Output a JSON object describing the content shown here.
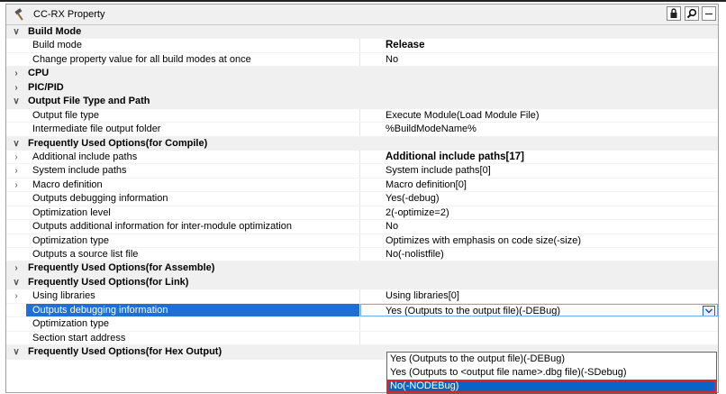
{
  "window": {
    "title": "CC-RX Property"
  },
  "toolbar": {
    "icons": [
      "lock-icon",
      "search-icon",
      "minimize-icon"
    ]
  },
  "rows": [
    {
      "type": "cat",
      "expander": "expanded",
      "name": "Build Mode"
    },
    {
      "type": "prop",
      "name": "Build mode",
      "value": "Release",
      "strong": true
    },
    {
      "type": "prop",
      "name": "Change property value for all build modes at once",
      "value": "No"
    },
    {
      "type": "cat",
      "expander": "collapsed",
      "name": "CPU"
    },
    {
      "type": "cat",
      "expander": "collapsed",
      "name": "PIC/PID"
    },
    {
      "type": "cat",
      "expander": "expanded",
      "name": "Output File Type and Path"
    },
    {
      "type": "prop",
      "name": "Output file type",
      "value": "Execute Module(Load Module File)"
    },
    {
      "type": "prop",
      "name": "Intermediate file output folder",
      "value": "%BuildModeName%"
    },
    {
      "type": "cat",
      "expander": "expanded",
      "name": "Frequently Used Options(for Compile)"
    },
    {
      "type": "prop",
      "expander": "collapsed",
      "name": "Additional include paths",
      "value": "Additional include paths[17]",
      "strong": true
    },
    {
      "type": "prop",
      "expander": "collapsed",
      "name": "System include paths",
      "value": "System include paths[0]"
    },
    {
      "type": "prop",
      "expander": "collapsed",
      "name": "Macro definition",
      "value": "Macro definition[0]"
    },
    {
      "type": "prop",
      "name": "Outputs debugging information",
      "value": "Yes(-debug)"
    },
    {
      "type": "prop",
      "name": "Optimization level",
      "value": "2(-optimize=2)"
    },
    {
      "type": "prop",
      "name": "Outputs additional information for inter-module optimization",
      "value": "No"
    },
    {
      "type": "prop",
      "name": "Optimization type",
      "value": "Optimizes with emphasis on code size(-size)"
    },
    {
      "type": "prop",
      "name": "Outputs a source list file",
      "value": "No(-nolistfile)"
    },
    {
      "type": "cat",
      "expander": "collapsed",
      "name": "Frequently Used Options(for Assemble)"
    },
    {
      "type": "cat",
      "expander": "expanded",
      "name": "Frequently Used Options(for Link)"
    },
    {
      "type": "prop",
      "expander": "collapsed",
      "name": "Using libraries",
      "value": "Using libraries[0]"
    },
    {
      "type": "prop",
      "name": "Outputs debugging information",
      "value": "Yes (Outputs to the output file)(-DEBug)",
      "selected": true
    },
    {
      "type": "prop",
      "name": "Optimization type",
      "value": ""
    },
    {
      "type": "prop",
      "name": "Section start address",
      "value": ""
    },
    {
      "type": "cat",
      "expander": "expanded",
      "name": "Frequently Used Options(for Hex Output)"
    }
  ],
  "dropdown": {
    "options": [
      "Yes (Outputs to the output file)(-DEBug)",
      "Yes (Outputs to <output file name>.dbg file)(-SDebug)",
      "No(-NODEBug)"
    ],
    "highlighted_index": 2
  }
}
